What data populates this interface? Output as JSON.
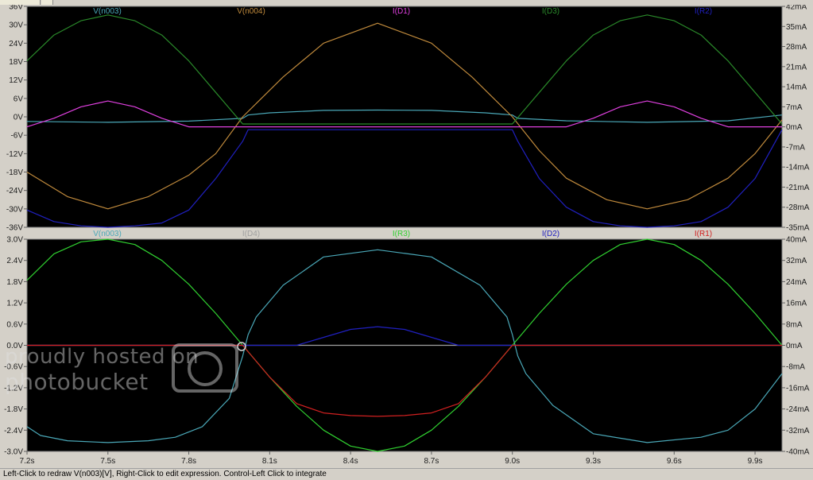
{
  "status_text": "Left-Click to redraw V(n003)[V],  Right-Click to edit expression. Control-Left Click to integrate",
  "watermark": {
    "line1": "proudly hosted on",
    "line2": "photobucket"
  },
  "chart_data": [
    {
      "type": "line",
      "title": "",
      "x_ticks": [
        "7.2s",
        "7.5s",
        "7.8s",
        "8.1s",
        "8.4s",
        "8.7s",
        "9.0s",
        "9.3s",
        "9.6s",
        "9.9s"
      ],
      "xlim": [
        7.2,
        10.0
      ],
      "left_axis": {
        "ticks": [
          "36V",
          "30V",
          "24V",
          "18V",
          "12V",
          "6V",
          "0V",
          "-6V",
          "-12V",
          "-18V",
          "-24V",
          "-30V",
          "-36V"
        ],
        "ylim": [
          -36,
          36
        ],
        "unit": "V"
      },
      "right_axis": {
        "ticks": [
          "42mA",
          "35mA",
          "28mA",
          "21mA",
          "14mA",
          "7mA",
          "0mA",
          "-7mA",
          "-14mA",
          "-21mA",
          "-28mA",
          "-35mA"
        ],
        "ylim": [
          -35,
          42
        ],
        "unit": "mA"
      },
      "legend": [
        {
          "name": "V(n003)",
          "color": "#4aa8b8"
        },
        {
          "name": "V(n004)",
          "color": "#c08a3c"
        },
        {
          "name": "I(D1)",
          "color": "#e040e0"
        },
        {
          "name": "I(D3)",
          "color": "#2a8a2a"
        },
        {
          "name": "I(R2)",
          "color": "#2020c0"
        }
      ],
      "series": [
        {
          "name": "V(n003)",
          "axis": "left",
          "color": "#4aa8b8",
          "x": [
            7.2,
            7.5,
            7.8,
            8.0,
            8.02,
            8.1,
            8.3,
            8.5,
            8.7,
            8.9,
            9.0,
            9.02,
            9.2,
            9.5,
            9.8,
            10.0
          ],
          "y": [
            -1.5,
            -1.8,
            -1.4,
            -0.5,
            0.6,
            1.3,
            2.1,
            2.2,
            2.1,
            1.3,
            0.6,
            -0.5,
            -1.3,
            -1.8,
            -1.3,
            0.6
          ]
        },
        {
          "name": "V(n004)",
          "axis": "left",
          "color": "#c08a3c",
          "x": [
            7.2,
            7.35,
            7.5,
            7.65,
            7.8,
            7.9,
            8.0,
            8.15,
            8.3,
            8.5,
            8.7,
            8.85,
            9.0,
            9.1,
            9.2,
            9.35,
            9.5,
            9.65,
            9.8,
            9.9,
            10.0
          ],
          "y": [
            -18,
            -26,
            -30,
            -26,
            -19,
            -12,
            0,
            13,
            24,
            30.5,
            24,
            13,
            0,
            -11,
            -20,
            -27,
            -30,
            -27,
            -20,
            -12,
            -1
          ]
        },
        {
          "name": "I(D1)",
          "axis": "right",
          "color": "#e040e0",
          "x": [
            7.2,
            7.3,
            7.4,
            7.5,
            7.6,
            7.7,
            7.8,
            8.0,
            9.0,
            9.2,
            9.3,
            9.4,
            9.5,
            9.6,
            9.7,
            9.8,
            10.0
          ],
          "y": [
            0,
            3,
            7,
            9,
            7,
            3,
            0,
            0,
            0,
            0,
            3,
            7,
            9,
            7,
            3,
            0,
            0
          ]
        },
        {
          "name": "I(D3)",
          "axis": "right",
          "color": "#2a8a2a",
          "x": [
            7.2,
            7.3,
            7.4,
            7.5,
            7.6,
            7.7,
            7.8,
            7.9,
            8.0,
            9.0,
            9.1,
            9.2,
            9.3,
            9.4,
            9.5,
            9.6,
            9.7,
            9.8,
            9.9,
            10.0
          ],
          "y": [
            23,
            32,
            37,
            39,
            37,
            32,
            23,
            12,
            1,
            1,
            12,
            23,
            32,
            37,
            39,
            37,
            32,
            23,
            12,
            1
          ]
        },
        {
          "name": "I(R2)",
          "axis": "right",
          "color": "#2020c0",
          "x": [
            7.2,
            7.3,
            7.4,
            7.5,
            7.6,
            7.7,
            7.8,
            7.9,
            8.0,
            8.02,
            9.0,
            9.02,
            9.1,
            9.2,
            9.3,
            9.4,
            9.5,
            9.6,
            9.7,
            9.8,
            9.9,
            10.0
          ],
          "y": [
            -29,
            -33,
            -34.5,
            -35,
            -34.5,
            -33.5,
            -29,
            -18,
            -5,
            -1,
            -1,
            -5,
            -18,
            -28,
            -33,
            -34.5,
            -35,
            -34.5,
            -33,
            -28,
            -18,
            -1
          ]
        }
      ]
    },
    {
      "type": "line",
      "title": "",
      "x_ticks": [
        "7.2s",
        "7.5s",
        "7.8s",
        "8.1s",
        "8.4s",
        "8.7s",
        "9.0s",
        "9.3s",
        "9.6s",
        "9.9s"
      ],
      "xlim": [
        7.2,
        10.0
      ],
      "left_axis": {
        "ticks": [
          "3.0V",
          "2.4V",
          "1.8V",
          "1.2V",
          "0.6V",
          "0.0V",
          "-0.6V",
          "-1.2V",
          "-1.8V",
          "-2.4V",
          "-3.0V"
        ],
        "ylim": [
          -3.0,
          3.0
        ],
        "unit": "V"
      },
      "right_axis": {
        "ticks": [
          "40mA",
          "32mA",
          "24mA",
          "16mA",
          "8mA",
          "0mA",
          "-8mA",
          "-16mA",
          "-24mA",
          "-32mA",
          "-40mA"
        ],
        "ylim": [
          -40,
          40
        ],
        "unit": "mA"
      },
      "legend": [
        {
          "name": "V(n003)",
          "color": "#4aa8b8"
        },
        {
          "name": "I(D4)",
          "color": "#a0a0a0"
        },
        {
          "name": "I(R3)",
          "color": "#30d030"
        },
        {
          "name": "I(D2)",
          "color": "#2020c0"
        },
        {
          "name": "I(R1)",
          "color": "#d02020"
        }
      ],
      "series": [
        {
          "name": "V(n003)",
          "axis": "left",
          "color": "#4aa8b8",
          "x": [
            7.2,
            7.25,
            7.35,
            7.5,
            7.65,
            7.75,
            7.85,
            7.95,
            8.0,
            8.02,
            8.05,
            8.15,
            8.3,
            8.5,
            8.7,
            8.88,
            8.98,
            9.0,
            9.02,
            9.05,
            9.15,
            9.3,
            9.5,
            9.7,
            9.8,
            9.9,
            10.0
          ],
          "y": [
            -2.3,
            -2.55,
            -2.7,
            -2.75,
            -2.7,
            -2.6,
            -2.3,
            -1.5,
            -0.3,
            0.3,
            0.8,
            1.7,
            2.5,
            2.7,
            2.5,
            1.7,
            0.8,
            0.3,
            -0.3,
            -0.8,
            -1.7,
            -2.5,
            -2.75,
            -2.6,
            -2.4,
            -1.8,
            -0.8
          ]
        },
        {
          "name": "I(D4)",
          "axis": "right",
          "color": "#a0a0a0",
          "x": [
            7.2,
            10.0
          ],
          "y": [
            0,
            0
          ]
        },
        {
          "name": "I(R3)",
          "axis": "right",
          "color": "#30d030",
          "x": [
            7.2,
            7.3,
            7.4,
            7.5,
            7.6,
            7.7,
            7.8,
            7.9,
            8.0,
            8.1,
            8.2,
            8.3,
            8.4,
            8.5,
            8.6,
            8.7,
            8.8,
            8.9,
            9.0,
            9.1,
            9.2,
            9.3,
            9.4,
            9.5,
            9.6,
            9.7,
            9.8,
            9.9,
            10.0
          ],
          "y": [
            24.5,
            34.5,
            39,
            40,
            38,
            32,
            23,
            12,
            0,
            -12,
            -23,
            -32,
            -38,
            -40,
            -38,
            -32,
            -23,
            -12,
            0,
            12,
            23,
            32,
            38,
            40,
            38,
            32,
            23,
            12,
            0
          ]
        },
        {
          "name": "I(D2)",
          "axis": "right",
          "color": "#2020c0",
          "x": [
            7.2,
            8.0,
            8.2,
            8.3,
            8.4,
            8.5,
            8.6,
            8.7,
            8.8,
            9.0,
            10.0
          ],
          "y": [
            0,
            0,
            0,
            3,
            6,
            7,
            6,
            3,
            0,
            0,
            0
          ]
        },
        {
          "name": "I(R1)",
          "axis": "right",
          "color": "#d02020",
          "x": [
            7.2,
            8.0,
            8.1,
            8.2,
            8.3,
            8.4,
            8.5,
            8.6,
            8.7,
            8.8,
            8.9,
            9.0,
            10.0
          ],
          "y": [
            0,
            0,
            -12,
            -22,
            -25.5,
            -26.5,
            -26.8,
            -26.5,
            -25.5,
            -22,
            -12,
            0,
            0
          ]
        }
      ]
    }
  ]
}
